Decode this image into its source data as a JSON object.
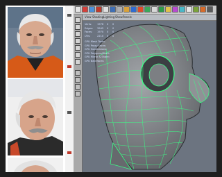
{
  "photos": [
    {
      "subject": "elderly man with mustache, front view"
    },
    {
      "subject": "elderly man with mustache, three-quarter view"
    },
    {
      "subject": "elderly man, top of head"
    }
  ],
  "app": {
    "panel_menu": [
      "View",
      "Shading",
      "Lighting",
      "Show",
      "Panels"
    ],
    "hud": {
      "rows": [
        {
          "label": "Verts:",
          "a": "1976",
          "b": "0",
          "c": "0"
        },
        {
          "label": "Edges:",
          "a": "3945",
          "b": "0",
          "c": "0"
        },
        {
          "label": "Faces:",
          "a": "1970",
          "b": "0",
          "c": "0"
        },
        {
          "label": "UVs:",
          "a": "2210",
          "b": "0",
          "c": "0"
        }
      ],
      "sections": [
        "GPU Mesh Tasks:",
        "GPU Proxy Faces:",
        "GPU Subdivisions:",
        "GPU Polygons/Shell:",
        "GPU Mirror & Share:",
        "GPU Backfaces:"
      ]
    }
  },
  "colors": {
    "wireframe": "#3bff86",
    "model_shade": "#8a8d91",
    "viewport_bg": "#6c7480"
  }
}
